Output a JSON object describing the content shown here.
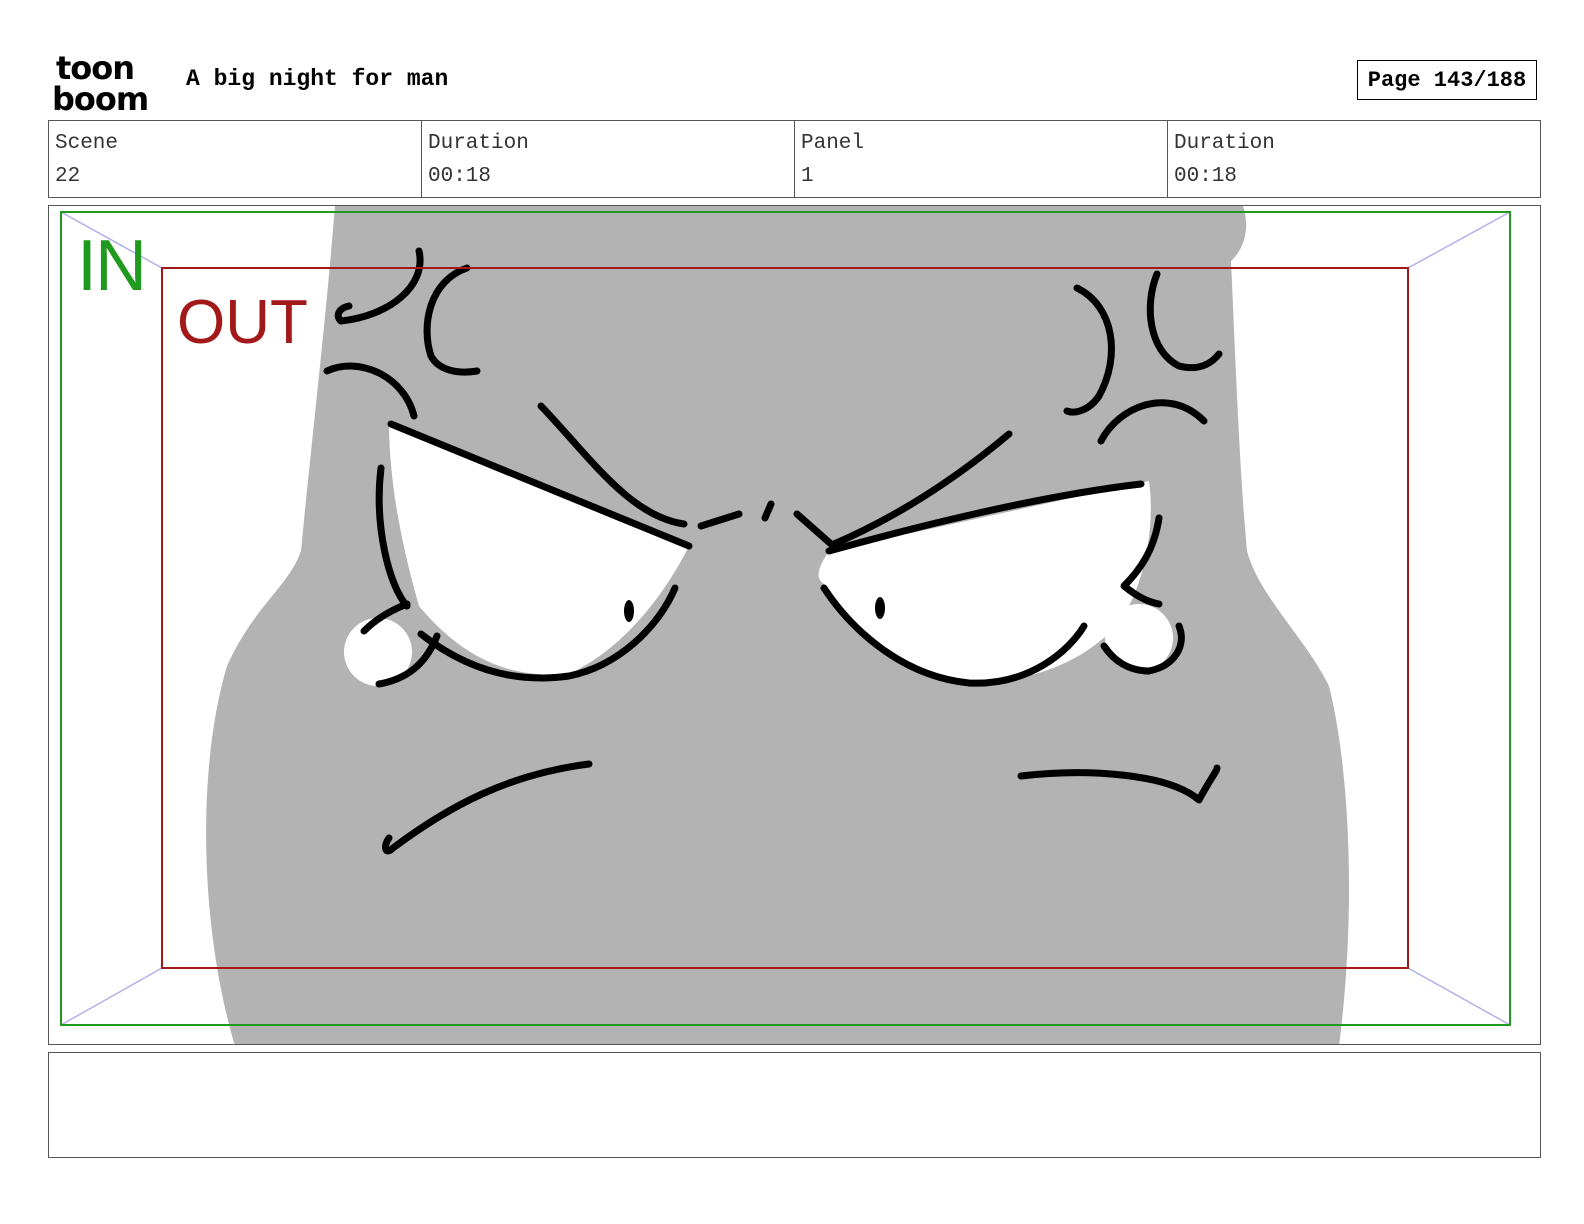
{
  "header": {
    "logo_top": "toon",
    "logo_bottom": "boom",
    "title": "A big night for man",
    "page": "Page 143/188"
  },
  "info": [
    {
      "label": "Scene",
      "value": "22"
    },
    {
      "label": "Duration",
      "value": "00:18"
    },
    {
      "label": "Panel",
      "value": "1"
    },
    {
      "label": "Duration",
      "value": "00:18"
    }
  ],
  "frame": {
    "in_label": "IN",
    "out_label": "OUT",
    "in_color": "#1f9a1f",
    "out_color": "#a31818",
    "figure_color": "#b3b3b3"
  },
  "notes": ""
}
